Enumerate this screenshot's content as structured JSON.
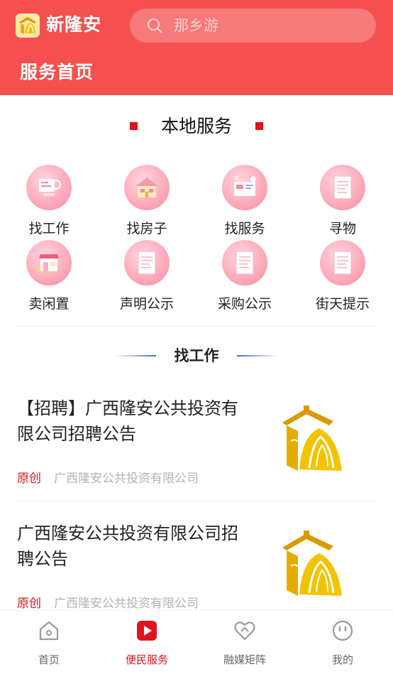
{
  "header": {
    "app_title": "新隆安",
    "search_placeholder": "那乡游",
    "page_title": "服务首页",
    "brand_color": "#f5504f"
  },
  "local_services": {
    "title": "本地服务",
    "items": [
      {
        "label": "找工作",
        "icon": "job-icon"
      },
      {
        "label": "找房子",
        "icon": "house-icon"
      },
      {
        "label": "找服务",
        "icon": "service-icon"
      },
      {
        "label": "寻物",
        "icon": "document-icon"
      },
      {
        "label": "卖闲置",
        "icon": "shop-icon"
      },
      {
        "label": "声明公示",
        "icon": "document-icon"
      },
      {
        "label": "采购公示",
        "icon": "document-icon"
      },
      {
        "label": "街天提示",
        "icon": "document-icon"
      }
    ]
  },
  "job_section": {
    "title": "找工作",
    "articles": [
      {
        "title": "【招聘】广西隆安公共投资有限公司招聘公告",
        "tag": "原创",
        "source": "广西隆安公共投资有限公司"
      },
      {
        "title": "广西隆安公共投资有限公司招聘公告",
        "tag": "原创",
        "source": "广西隆安公共投资有限公司"
      }
    ]
  },
  "tabbar": {
    "items": [
      {
        "label": "首页",
        "icon": "home-icon"
      },
      {
        "label": "便民服务",
        "icon": "play-icon"
      },
      {
        "label": "融媒矩阵",
        "icon": "heart-link-icon"
      },
      {
        "label": "我的",
        "icon": "smile-icon"
      }
    ],
    "active_color": "#e0141c"
  }
}
